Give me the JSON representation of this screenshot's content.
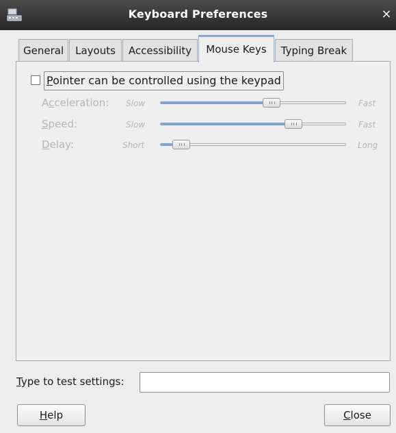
{
  "window": {
    "title": "Keyboard Preferences",
    "close_glyph": "×",
    "app_icon": "keyboard-icon"
  },
  "tabs": [
    {
      "label": "General",
      "active": false
    },
    {
      "label": "Layouts",
      "active": false
    },
    {
      "label": "Accessibility",
      "active": false
    },
    {
      "label": "Mouse Keys",
      "active": true
    },
    {
      "label": "Typing Break",
      "active": false
    }
  ],
  "mouse_keys": {
    "checkbox": {
      "label_mnemonic": "P",
      "label_rest": "ointer can be controlled using the keypad",
      "checked": false
    },
    "sliders": [
      {
        "label_pre": "A",
        "label_mnemonic": "c",
        "label_rest": "celeration:",
        "min_label": "Slow",
        "max_label": "Fast",
        "value": 0.6,
        "enabled": false
      },
      {
        "label_pre": "",
        "label_mnemonic": "S",
        "label_rest": "peed:",
        "min_label": "Slow",
        "max_label": "Fast",
        "value": 0.72,
        "enabled": false
      },
      {
        "label_pre": "",
        "label_mnemonic": "D",
        "label_rest": "elay:",
        "min_label": "Short",
        "max_label": "Long",
        "value": 0.11,
        "enabled": false
      }
    ]
  },
  "test": {
    "label_mnemonic": "T",
    "label_rest": "ype to test settings:",
    "value": "",
    "placeholder": ""
  },
  "buttons": {
    "help": {
      "mnemonic": "H",
      "rest": "elp"
    },
    "close": {
      "mnemonic": "C",
      "rest": "lose"
    }
  },
  "colors": {
    "slider_fill": "#7fa3d7",
    "disabled_text": "#b5b5b5",
    "active_tab_accent": "#8aa7cf"
  }
}
